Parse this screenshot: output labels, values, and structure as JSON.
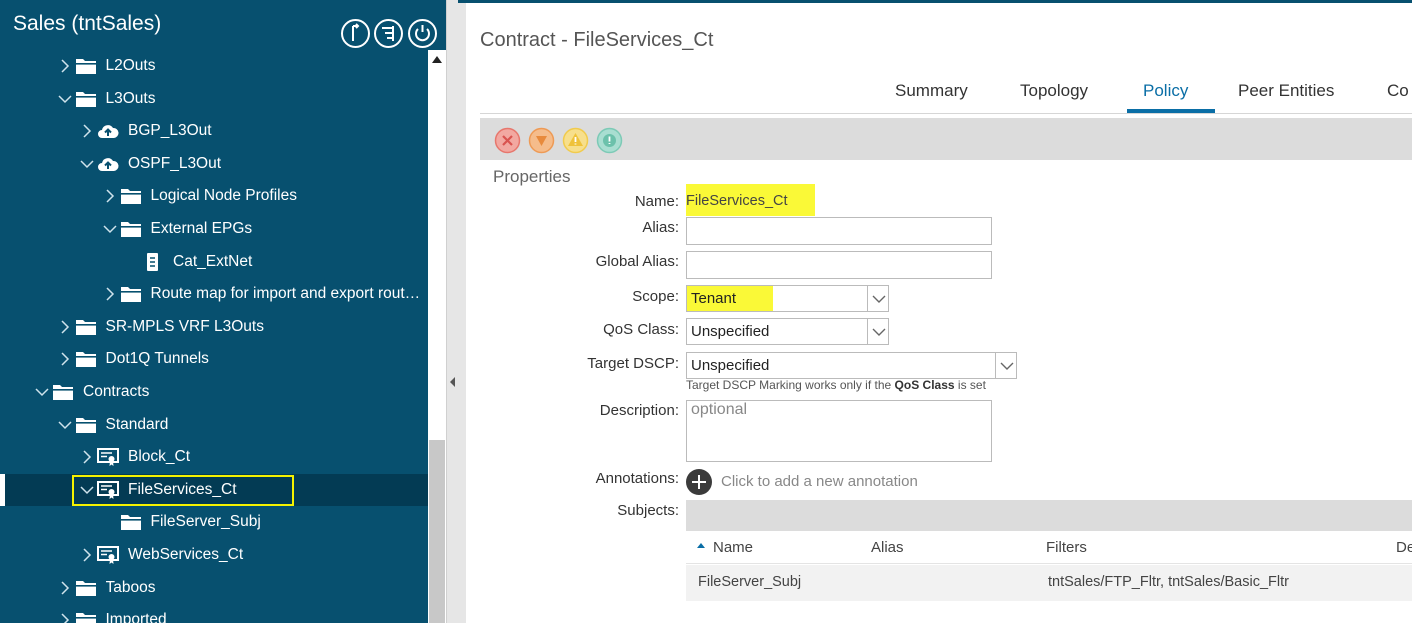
{
  "sidebar": {
    "title": "Sales (tntSales)",
    "tree": [
      {
        "label": "L2Outs",
        "expanded": false,
        "icon": "folder-icon"
      },
      {
        "label": "L3Outs",
        "expanded": true,
        "icon": "folder-icon"
      },
      {
        "label": "BGP_L3Out",
        "expanded": false,
        "icon": "cloud-upload-icon"
      },
      {
        "label": "OSPF_L3Out",
        "expanded": true,
        "icon": "cloud-upload-icon"
      },
      {
        "label": "Logical Node Profiles",
        "expanded": false,
        "icon": "folder-icon"
      },
      {
        "label": "External EPGs",
        "expanded": true,
        "icon": "folder-icon"
      },
      {
        "label": "Cat_ExtNet",
        "expanded": null,
        "icon": "document-icon"
      },
      {
        "label": "Route map for import and export route...",
        "expanded": false,
        "icon": "folder-icon"
      },
      {
        "label": "SR-MPLS VRF L3Outs",
        "expanded": false,
        "icon": "folder-icon"
      },
      {
        "label": "Dot1Q Tunnels",
        "expanded": false,
        "icon": "folder-icon"
      },
      {
        "label": "Contracts",
        "expanded": true,
        "icon": "folder-icon"
      },
      {
        "label": "Standard",
        "expanded": true,
        "icon": "folder-icon"
      },
      {
        "label": "Block_Ct",
        "expanded": false,
        "icon": "contract-icon"
      },
      {
        "label": "FileServices_Ct",
        "expanded": true,
        "icon": "contract-icon",
        "selected": true
      },
      {
        "label": "FileServer_Subj",
        "expanded": null,
        "icon": "folder-icon"
      },
      {
        "label": "WebServices_Ct",
        "expanded": false,
        "icon": "contract-icon"
      },
      {
        "label": "Taboos",
        "expanded": false,
        "icon": "folder-icon"
      },
      {
        "label": "Imported",
        "expanded": false,
        "icon": "folder-icon"
      }
    ]
  },
  "main": {
    "title": "Contract - FileServices_Ct",
    "tabs": [
      {
        "label": "Summary",
        "active": false
      },
      {
        "label": "Topology",
        "active": false
      },
      {
        "label": "Policy",
        "active": true
      },
      {
        "label": "Peer Entities",
        "active": false
      },
      {
        "label": "Co",
        "active": false
      }
    ],
    "toolbar_icons": [
      "delete-fault-icon",
      "major-fault-icon",
      "minor-fault-icon",
      "warning-fault-icon"
    ],
    "section_title": "Properties",
    "form": {
      "name_label": "Name:",
      "name_value": "FileServices_Ct",
      "alias_label": "Alias:",
      "alias_value": "",
      "global_alias_label": "Global Alias:",
      "global_alias_value": "",
      "scope_label": "Scope:",
      "scope_value": "Tenant",
      "qos_label": "QoS Class:",
      "qos_value": "Unspecified",
      "dscp_label": "Target DSCP:",
      "dscp_value": "Unspecified",
      "dscp_hint_prefix": "Target DSCP Marking works only if the",
      "dscp_hint_bold": "QoS Class",
      "dscp_hint_suffix": "is set",
      "description_label": "Description:",
      "description_placeholder": "optional",
      "annotations_label": "Annotations:",
      "annotations_add": "Click to add a new annotation",
      "subjects_label": "Subjects:"
    },
    "subjects_table": {
      "columns": [
        "Name",
        "Alias",
        "Filters",
        "De"
      ],
      "rows": [
        {
          "name": "FileServer_Subj",
          "alias": "",
          "filters": "tntSales/FTP_Fltr, tntSales/Basic_Fltr",
          "desc": ""
        }
      ]
    }
  },
  "colors": {
    "sidebar_bg": "#07506f",
    "selected_row": "#033b54",
    "highlight": "#faf937",
    "accent": "#0a6ea6"
  }
}
